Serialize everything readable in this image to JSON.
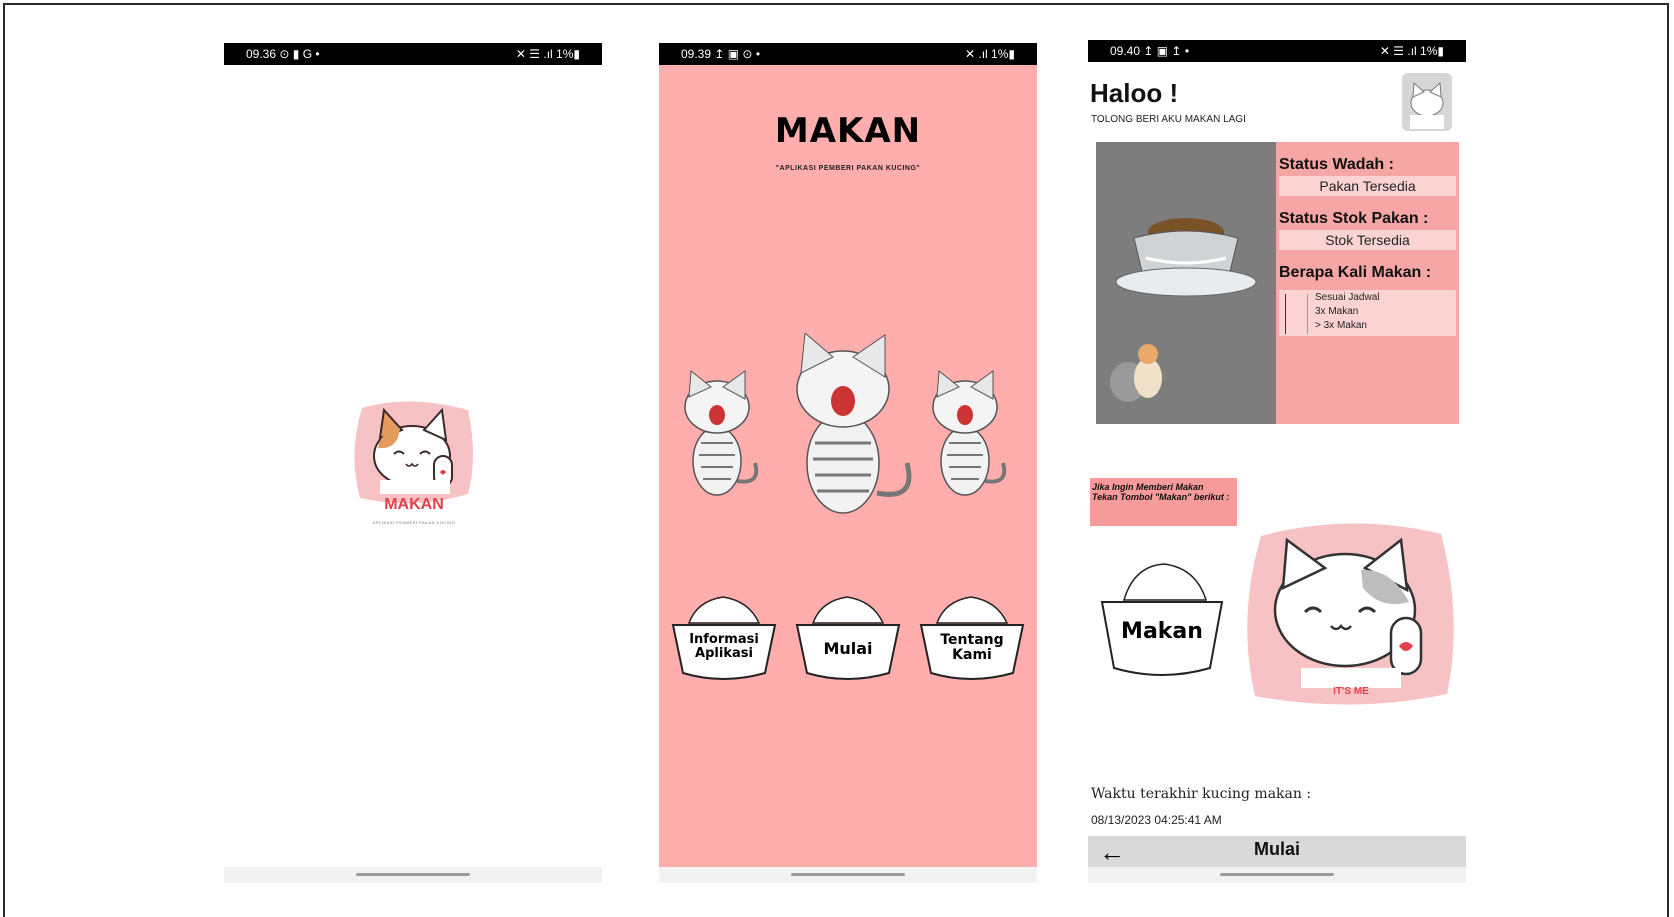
{
  "screen1": {
    "status_time": "09.36",
    "status_icons_left": "⊙ ▮ G •",
    "status_right": "✕ ☰ .ıl 1%▮",
    "logo_text": "MAKAN",
    "logo_subtitle": "APLIKASI PEMBERI PAKAN KUCING"
  },
  "screen2": {
    "status_time": "09.39",
    "status_icons_left": "↥ ▣ ⊙ •",
    "status_right": "✕ .ıl 1%▮",
    "title": "MAKAN",
    "subtitle": "\"APLIKASI PEMBERI PAKAN KUCING\"",
    "buttons": [
      {
        "label_line1": "Informasi",
        "label_line2": "Aplikasi"
      },
      {
        "label_line1": "Mulai",
        "label_line2": ""
      },
      {
        "label_line1": "Tentang",
        "label_line2": "Kami"
      }
    ],
    "background_color": "#ffadad"
  },
  "screen3": {
    "status_time": "09.40",
    "status_icons_left": "↥ ▣ ↥ •",
    "status_right": "✕ ☰ .ıl 1%▮",
    "greeting": "Haloo !",
    "greeting_sub": "TOLONG BERI AKU MAKAN LAGI",
    "status_wadah_label": "Status Wadah :",
    "status_wadah_value": "Pakan Tersedia",
    "status_stok_label": "Status Stok Pakan :",
    "status_stok_value": "Stok Tersedia",
    "berapa_kali_label": "Berapa Kali Makan :",
    "options": [
      "Sesuai Jadwal",
      "3x Makan",
      "> 3x Makan"
    ],
    "hint_line1": "Jika Ingin Memberi Makan",
    "hint_line2": "Tekan Tombol \"Makan\" berikut :",
    "makan_button_label": "Makan",
    "cat_caption": "IT'S ME",
    "last_fed_label": "Waktu terakhir kucing makan :",
    "last_fed_time": "08/13/2023 04:25:41 AM",
    "appbar_back": "←",
    "appbar_title": "Mulai"
  }
}
